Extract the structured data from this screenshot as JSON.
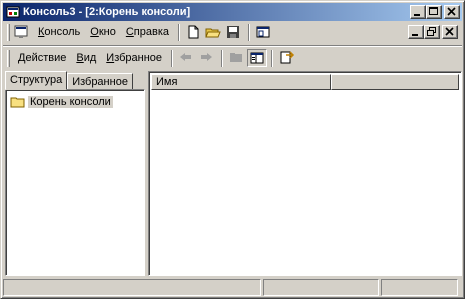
{
  "window": {
    "title": "Консоль3 - [2:Корень консоли]"
  },
  "menubar": {
    "items": [
      "Консоль",
      "Окно",
      "Справка"
    ]
  },
  "toolbar2": {
    "items": [
      "Действие",
      "Вид",
      "Избранное"
    ]
  },
  "tabs": [
    {
      "label": "Структура",
      "active": true
    },
    {
      "label": "Избранное",
      "active": false
    }
  ],
  "tree": {
    "root_label": "Корень консоли"
  },
  "list": {
    "columns": [
      "Имя",
      ""
    ]
  },
  "colors": {
    "title_start": "#0a246a",
    "title_end": "#a6caf0",
    "face": "#d4d0c8"
  },
  "icons": [
    "mmc-icon",
    "new-document-icon",
    "open-folder-icon",
    "save-disk-icon",
    "window-icon",
    "back-arrow-icon",
    "forward-arrow-icon",
    "up-folder-icon",
    "show-tree-icon",
    "export-list-icon"
  ]
}
